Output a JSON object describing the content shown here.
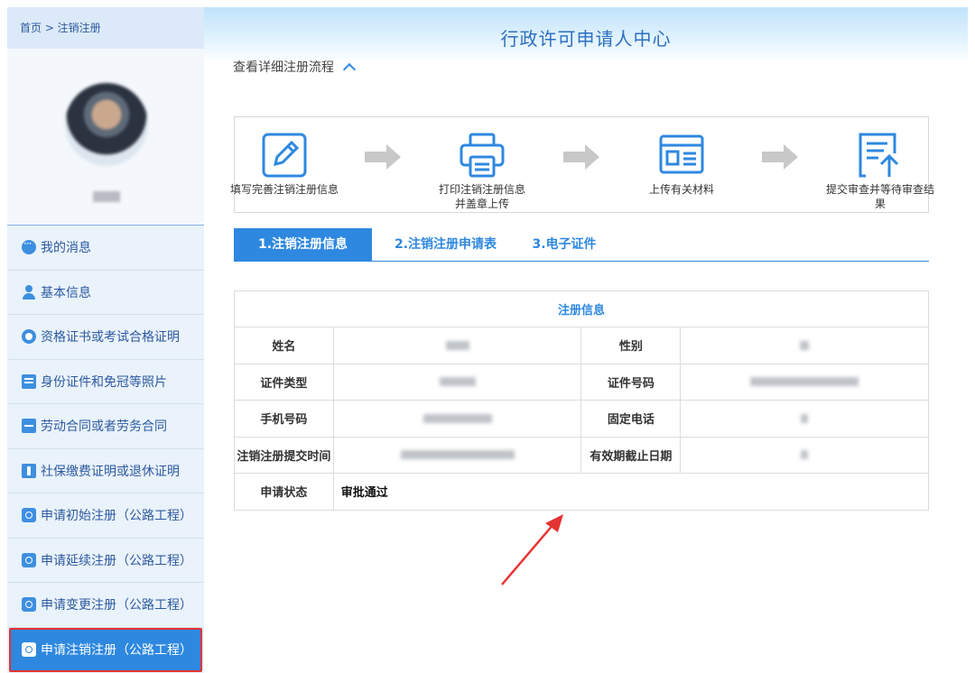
{
  "breadcrumb": "首页 > 注销注册",
  "sidebar": {
    "items": [
      {
        "label": "我的消息",
        "icon": "message-icon"
      },
      {
        "label": "基本信息",
        "icon": "user-icon"
      },
      {
        "label": "资格证书或考试合格证明",
        "icon": "certificate-icon"
      },
      {
        "label": "身份证件和免冠等照片",
        "icon": "id-card-icon"
      },
      {
        "label": "劳动合同或者劳务合同",
        "icon": "folder-icon"
      },
      {
        "label": "社保缴费证明或退休证明",
        "icon": "document-icon"
      },
      {
        "label": "申请初始注册（公路工程）",
        "icon": "camera-icon"
      },
      {
        "label": "申请延续注册（公路工程）",
        "icon": "camera-icon"
      },
      {
        "label": "申请变更注册（公路工程）",
        "icon": "camera-icon"
      },
      {
        "label": "申请注销注册（公路工程）",
        "icon": "camera-icon"
      }
    ]
  },
  "header": {
    "title": "行政许可申请人中心"
  },
  "flow_toggle": "查看详细注册流程",
  "steps": [
    {
      "label": "填写完善注销注册信息",
      "icon": "edit-icon"
    },
    {
      "label": "打印注销注册信息并盖章上传",
      "icon": "printer-icon"
    },
    {
      "label": "上传有关材料",
      "icon": "upload-doc-icon"
    },
    {
      "label": "提交审查并等待审查结果",
      "icon": "submit-icon"
    }
  ],
  "tabs": [
    "1.注销注册信息",
    "2.注销注册申请表",
    "3.电子证件"
  ],
  "info": {
    "caption": "注册信息",
    "labels": {
      "name": "姓名",
      "gender": "性别",
      "id_type": "证件类型",
      "id_number": "证件号码",
      "mobile": "手机号码",
      "phone": "固定电话",
      "submit_time": "注销注册提交时间",
      "expiry": "有效期截止日期",
      "status": "申请状态"
    },
    "status_value": "审批通过"
  },
  "colors": {
    "accent": "#2e88e0",
    "highlight": "#e53333"
  }
}
